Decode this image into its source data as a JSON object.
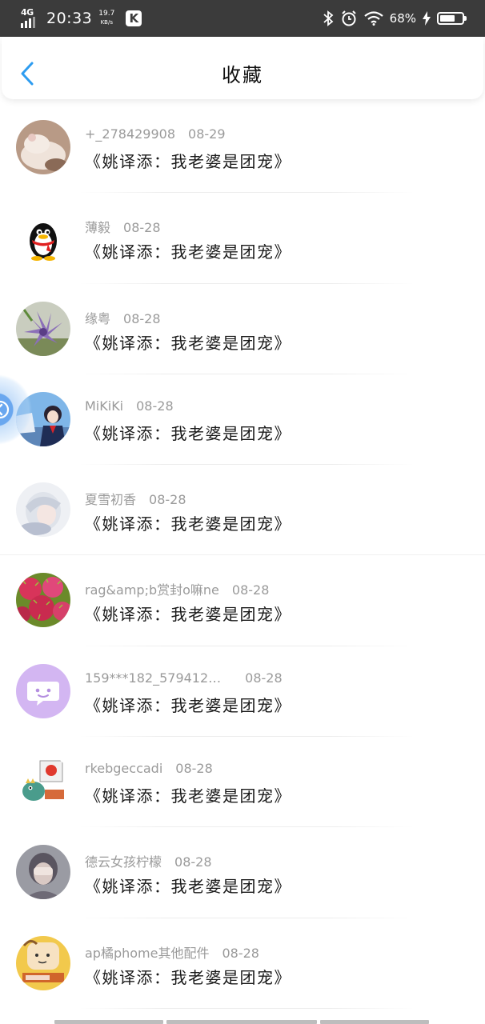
{
  "status_bar": {
    "network": "4G",
    "time": "20:33",
    "speed_value": "19.7",
    "speed_unit": "KB/s",
    "app_icon_letter": "K",
    "battery_percent": "68%",
    "battery_level": 0.68,
    "icons": [
      "bluetooth-icon",
      "alarm-icon",
      "wifi-icon",
      "charging-icon"
    ]
  },
  "header": {
    "title": "收藏",
    "back_icon": "chevron-left-icon",
    "accent_color": "#2d9cf0"
  },
  "favorites": [
    {
      "user": "+_278429908",
      "date": "08-29",
      "content": "《姚译添：我老婆是团宠》",
      "avatar": "hamster-photo"
    },
    {
      "user": "薄毅",
      "date": "08-28",
      "content": "《姚译添：我老婆是团宠》",
      "avatar": "qq-penguin"
    },
    {
      "user": "缘粤",
      "date": "08-28",
      "content": "《姚译添：我老婆是团宠》",
      "avatar": "purple-flower-photo"
    },
    {
      "user": "MiKiKi",
      "date": "08-28",
      "content": "《姚译添：我老婆是团宠》",
      "avatar": "anime-girl-blue-sky"
    },
    {
      "user": "夏雪初香",
      "date": "08-28",
      "content": "《姚译添：我老婆是团宠》",
      "avatar": "anime-girl-white-hair"
    },
    {
      "user": "rag&amp;b赏封o嘛ne",
      "date": "08-28",
      "content": "《姚译添：我老婆是团宠》",
      "avatar": "rambutan-photo"
    },
    {
      "user": "159***182_579412…",
      "date": "08-28",
      "content": "《姚译添：我老婆是团宠》",
      "avatar": "chat-bubble-purple"
    },
    {
      "user": "rkebgeccadi",
      "date": "08-28",
      "content": "《姚译添：我老婆是团宠》",
      "avatar": "cartoon-dinosaur"
    },
    {
      "user": "德云女孩柠檬",
      "date": "08-28",
      "content": "《姚译添：我老婆是团宠》",
      "avatar": "girl-covering-face"
    },
    {
      "user": "ap橘phome其他配件",
      "date": "08-28",
      "content": "《姚译添：我老婆是团宠》",
      "avatar": "cancer-cartoon"
    }
  ],
  "floating_button": {
    "icon": "chevron-left-circle-icon",
    "color": "#6aa7ef"
  }
}
